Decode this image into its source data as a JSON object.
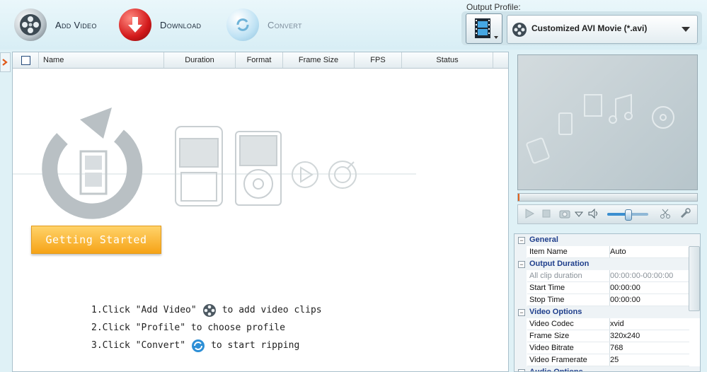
{
  "toolbar": {
    "add_video_label": "Add Video",
    "download_label": "Download",
    "convert_label": "Convert"
  },
  "output_profile": {
    "label": "Output Profile:",
    "selected": "Customized AVI Movie (*.avi)"
  },
  "table": {
    "columns": [
      "Name",
      "Duration",
      "Format",
      "Frame Size",
      "FPS",
      "Status"
    ]
  },
  "getting_started": {
    "button_label": "Getting Started",
    "steps": [
      {
        "prefix": "1.Click \"Add Video\"",
        "suffix": "to add video clips"
      },
      {
        "prefix": "2.Click \"Profile\" to choose profile",
        "suffix": ""
      },
      {
        "prefix": "3.Click \"Convert\"",
        "suffix": "to start ripping"
      }
    ]
  },
  "player": {
    "volume_level": 0.5
  },
  "properties": {
    "groups": [
      {
        "title": "General",
        "items": [
          {
            "key": "Item Name",
            "value": "Auto"
          }
        ]
      },
      {
        "title": "Output Duration",
        "items": [
          {
            "key": "All clip duration",
            "value": "00:00:00-00:00:00",
            "disabled": true
          },
          {
            "key": "Start Time",
            "value": "00:00:00"
          },
          {
            "key": "Stop Time",
            "value": "00:00:00"
          }
        ]
      },
      {
        "title": "Video Options",
        "items": [
          {
            "key": "Video Codec",
            "value": "xvid"
          },
          {
            "key": "Frame Size",
            "value": "320x240"
          },
          {
            "key": "Video Bitrate",
            "value": "768"
          },
          {
            "key": "Video Framerate",
            "value": "25"
          }
        ]
      },
      {
        "title": "Audio Options",
        "items": []
      }
    ]
  },
  "colors": {
    "accent_orange": "#f6a317",
    "group_title": "#1f3f8c",
    "background": "#dff1f6"
  }
}
